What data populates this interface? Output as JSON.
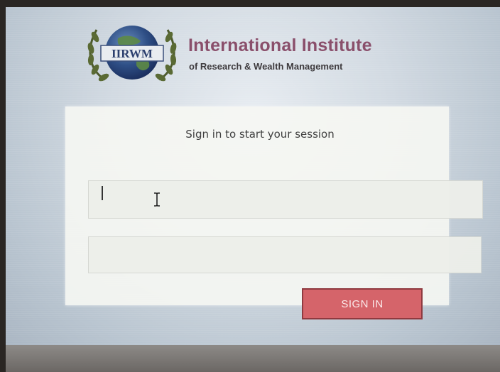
{
  "branding": {
    "logo_text": "IIRWM",
    "title": "International Institute",
    "subtitle": "of Research & Wealth Management"
  },
  "login": {
    "message": "Sign in to start your session",
    "username": {
      "value": "",
      "placeholder": ""
    },
    "password": {
      "value": "",
      "placeholder": ""
    },
    "sign_in_label": "SIGN IN"
  },
  "colors": {
    "brand_title": "#8a4f6b",
    "sign_in_button": "#d5646a",
    "sign_in_border": "#8f3a40"
  }
}
